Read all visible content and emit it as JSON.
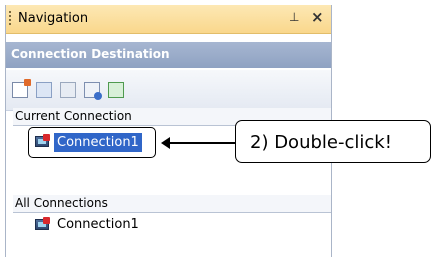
{
  "panel": {
    "title": "Navigation",
    "pin_glyph": "⊥",
    "close_glyph": "×",
    "header": "Connection Destination",
    "toolbar": [
      {
        "icon": "new-connection-icon"
      },
      {
        "icon": "copy-icon"
      },
      {
        "icon": "paste-icon"
      },
      {
        "icon": "properties-icon"
      },
      {
        "icon": "refresh-icon"
      }
    ],
    "current_section": "Current Connection",
    "current_item": "Connection1",
    "all_section": "All Connections",
    "all_item": "Connection1"
  },
  "annotation": {
    "callout": "2) Double-click!"
  },
  "colors": {
    "titlebar": "#f9d78c",
    "header": "#8fa2c2",
    "selection": "#3066c8"
  }
}
